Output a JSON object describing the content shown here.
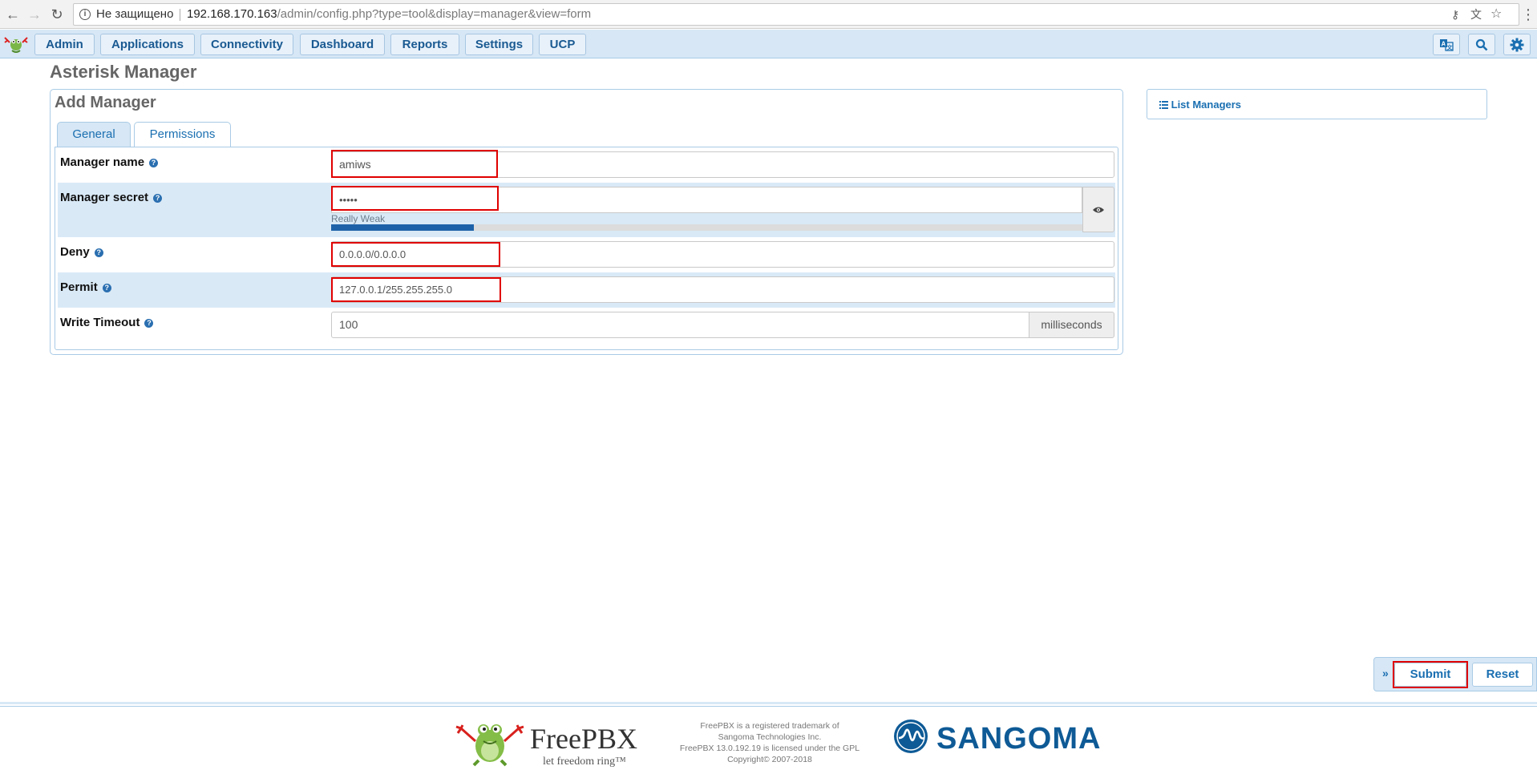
{
  "browser": {
    "security_label": "Не защищено",
    "url_host": "192.168.170.163",
    "url_path": "/admin/config.php?type=tool&display=manager&view=form"
  },
  "topnav": {
    "tabs": [
      {
        "label": "Admin"
      },
      {
        "label": "Applications"
      },
      {
        "label": "Connectivity"
      },
      {
        "label": "Dashboard"
      },
      {
        "label": "Reports"
      },
      {
        "label": "Settings"
      },
      {
        "label": "UCP"
      }
    ],
    "icons": [
      "translate-icon",
      "search-icon",
      "gear-icon"
    ]
  },
  "page": {
    "title": "Asterisk Manager"
  },
  "form": {
    "title": "Add Manager",
    "tabs": {
      "general": "General",
      "permissions": "Permissions"
    },
    "fields": {
      "manager_name": {
        "label": "Manager name",
        "value": "amiws"
      },
      "manager_secret": {
        "label": "Manager secret",
        "value": "•••••",
        "strength_label": "Really Weak",
        "strength": 0.19
      },
      "deny": {
        "label": "Deny",
        "value": "0.0.0.0/0.0.0.0"
      },
      "permit": {
        "label": "Permit",
        "value": "127.0.0.1/255.255.255.0"
      },
      "write_timeout": {
        "label": "Write Timeout",
        "value": "100",
        "unit": "milliseconds"
      }
    },
    "help_glyph": "?"
  },
  "sidebar": {
    "list_managers": "List Managers"
  },
  "actions": {
    "submit": "Submit",
    "reset": "Reset",
    "toggle": "»"
  },
  "footer": {
    "brand": "FreePBX",
    "tagline": "let freedom ring™",
    "legal": [
      "FreePBX is a registered trademark of",
      "Sangoma Technologies Inc.",
      "FreePBX 13.0.192.19 is licensed under the GPL",
      "Copyright© 2007-2018"
    ],
    "sangoma": "SANGOMA"
  },
  "colors": {
    "accent": "#1a6fb1",
    "nav_bg": "#d7e7f5",
    "highlight": "#e00000",
    "strength_fill": "#1d62a8"
  }
}
